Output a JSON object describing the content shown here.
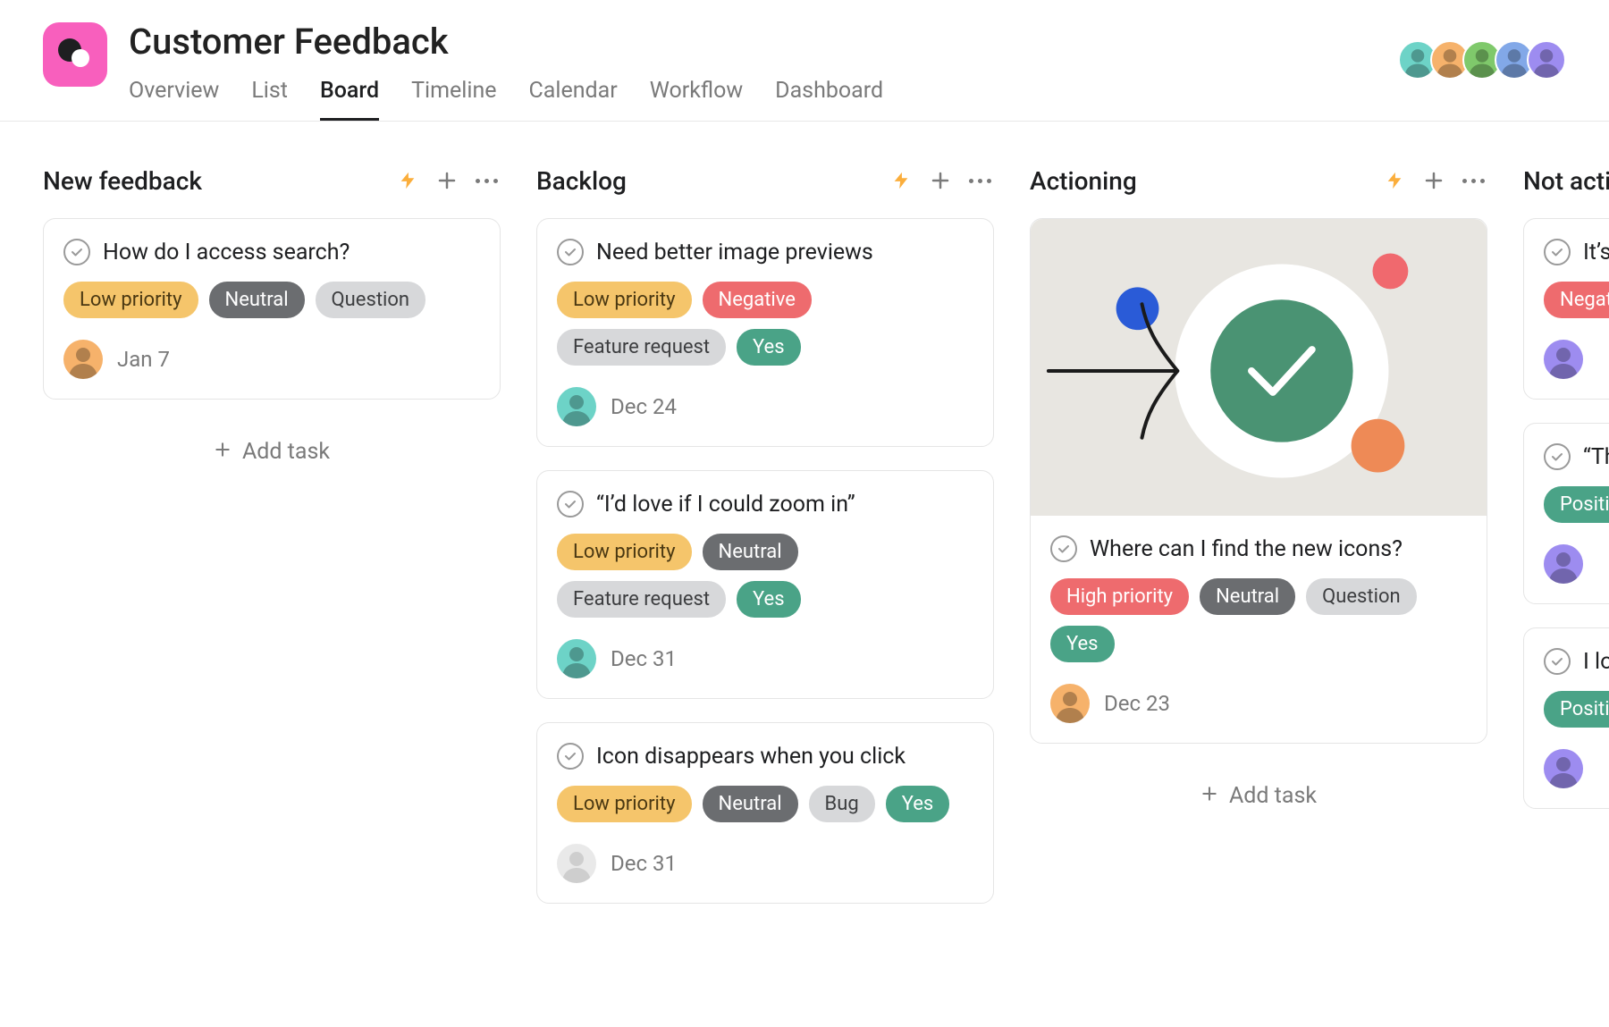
{
  "project": {
    "title": "Customer Feedback",
    "tabs": [
      "Overview",
      "List",
      "Board",
      "Timeline",
      "Calendar",
      "Workflow",
      "Dashboard"
    ],
    "active_tab": 2
  },
  "header_avatars": [
    {
      "bg": "#6dd3c7"
    },
    {
      "bg": "#f6b26b"
    },
    {
      "bg": "#7fc96b"
    },
    {
      "bg": "#82a8e8"
    },
    {
      "bg": "#9d8cf0"
    }
  ],
  "tag_colors": {
    "Low priority": "tag-yellow",
    "High priority": "tag-red",
    "Neutral": "tag-gray",
    "Negative": "tag-red",
    "Positive": "tag-green",
    "Question": "tag-ltgray",
    "Feature request": "tag-ltgray",
    "Bug": "tag-ltgray",
    "Yes": "tag-green"
  },
  "add_task_label": "Add task",
  "columns": [
    {
      "title": "New feedback",
      "show_add_task": true,
      "cards": [
        {
          "title": "How do I access search?",
          "tags": [
            "Low priority",
            "Neutral",
            "Question"
          ],
          "avatar_bg": "#f6b26b",
          "date": "Jan 7"
        }
      ]
    },
    {
      "title": "Backlog",
      "show_add_task": false,
      "cards": [
        {
          "title": "Need better image previews",
          "tags": [
            "Low priority",
            "Negative",
            "Feature request",
            "Yes"
          ],
          "avatar_bg": "#6dd3c7",
          "date": "Dec 24"
        },
        {
          "title": "“I’d love if I could zoom in”",
          "tags": [
            "Low priority",
            "Neutral",
            "Feature request",
            "Yes"
          ],
          "avatar_bg": "#6dd3c7",
          "date": "Dec 31"
        },
        {
          "title": "Icon disappears when you click",
          "tags": [
            "Low priority",
            "Neutral",
            "Bug",
            "Yes"
          ],
          "avatar_bg": "#cfcfcf",
          "avatar_faded": true,
          "date": "Dec 31"
        }
      ]
    },
    {
      "title": "Actioning",
      "show_add_task": true,
      "cards": [
        {
          "has_cover": true,
          "title": "Where can I find the new icons?",
          "tags": [
            "High priority",
            "Neutral",
            "Question",
            "Yes"
          ],
          "avatar_bg": "#f6b26b",
          "date": "Dec 23"
        }
      ]
    },
    {
      "title": "Not action",
      "show_add_task": false,
      "cards": [
        {
          "title": "It’s ha",
          "tags": [
            "Negative"
          ],
          "avatar_bg": "#9d8cf0",
          "date": ""
        },
        {
          "title": "“The",
          "tags": [
            "Positive"
          ],
          "avatar_bg": "#9d8cf0",
          "date": ""
        },
        {
          "title": "I love",
          "tags": [
            "Positive"
          ],
          "avatar_bg": "#9d8cf0",
          "date": ""
        }
      ]
    }
  ]
}
